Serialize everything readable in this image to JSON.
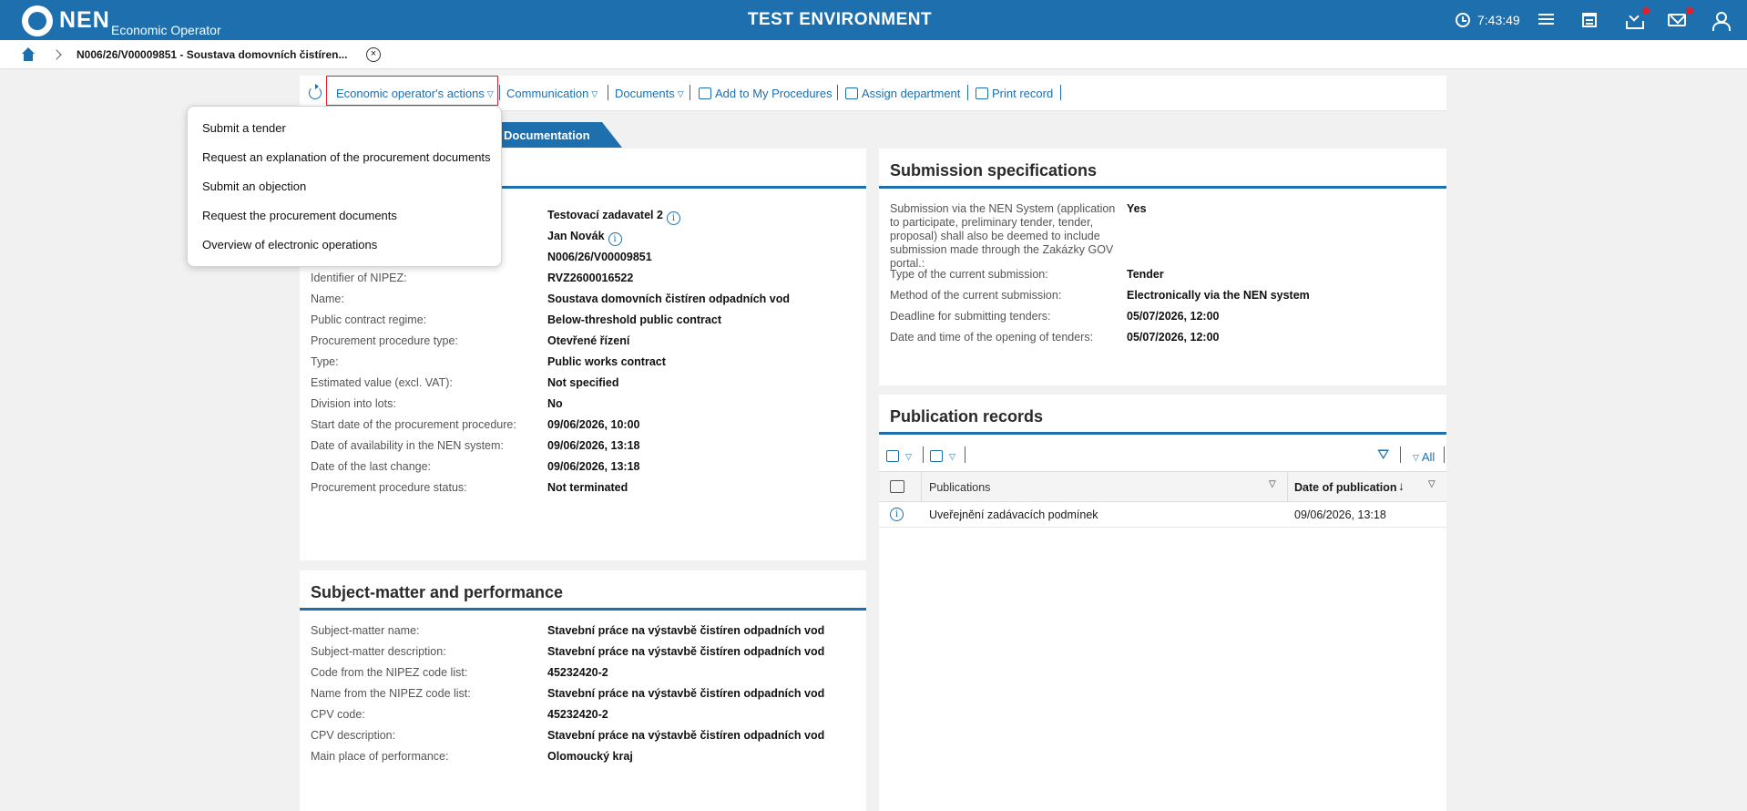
{
  "header": {
    "logo_text": "NEN",
    "logo_subtitle": "Economic Operator",
    "environment": "TEST ENVIRONMENT",
    "clock": "7:43:49",
    "accent": "#1d6fae"
  },
  "breadcrumb": {
    "current": "N006/26/V00009851 - Soustava domovních čistíren..."
  },
  "toolbar": {
    "eo_actions": "Economic operator's actions",
    "communication": "Communication",
    "documents": "Documents",
    "add_to_my": "Add to My Procedures",
    "assign_department": "Assign department",
    "print_record": "Print record"
  },
  "tab": {
    "label": "Documentation"
  },
  "dropdown": {
    "items": [
      "Submit a tender",
      "Request an explanation of the procurement documents",
      "Submit an objection",
      "Request the procurement documents",
      "Overview of electronic operations"
    ]
  },
  "basic": {
    "rows": [
      {
        "label": "",
        "value": "Testovací zadavatel 2"
      },
      {
        "label": "",
        "value": "Jan Novák"
      },
      {
        "label": "",
        "value": "N006/26/V00009851"
      },
      {
        "label": "Identifier of NIPEZ:",
        "value": "RVZ2600016522"
      },
      {
        "label": "Name:",
        "value": "Soustava domovních čistíren odpadních vod"
      },
      {
        "label": "Public contract regime:",
        "value": "Below-threshold public contract"
      },
      {
        "label": "Procurement procedure type:",
        "value": "Otevřené řízení"
      },
      {
        "label": "Type:",
        "value": "Public works contract"
      },
      {
        "label": "Estimated value (excl. VAT):",
        "value": "Not specified"
      },
      {
        "label": "Division into lots:",
        "value": "No"
      },
      {
        "label": "Start date of the procurement procedure:",
        "value": "09/06/2026, 10:00"
      },
      {
        "label": "Date of availability in the NEN system:",
        "value": "09/06/2026, 13:18"
      },
      {
        "label": "Date of the last change:",
        "value": "09/06/2026, 13:18"
      },
      {
        "label": "Procurement procedure status:",
        "value": "Not terminated"
      }
    ]
  },
  "subject": {
    "title": "Subject-matter and performance",
    "rows": [
      {
        "label": "Subject-matter name:",
        "value": "Stavební práce na výstavbě čistíren odpadních vod"
      },
      {
        "label": "Subject-matter description:",
        "value": "Stavební práce na výstavbě čistíren odpadních vod"
      },
      {
        "label": "Code from the NIPEZ code list:",
        "value": "45232420-2"
      },
      {
        "label": "Name from the NIPEZ code list:",
        "value": "Stavební práce na výstavbě čistíren odpadních vod"
      },
      {
        "label": "CPV code:",
        "value": "45232420-2"
      },
      {
        "label": "CPV description:",
        "value": "Stavební práce na výstavbě čistíren odpadních vod"
      },
      {
        "label": "Main place of performance:",
        "value": "Olomoucký kraj"
      }
    ]
  },
  "submission": {
    "title": "Submission specifications",
    "first_label": [
      "Submission via the NEN System (application",
      "to participate, preliminary tender, tender,",
      "proposal) shall also be deemed to include",
      "submission made through the Zakázky GOV",
      "portal.:"
    ],
    "first_value": "Yes",
    "rows": [
      {
        "label": "Type of the current submission:",
        "value": "Tender"
      },
      {
        "label": "Method of the current submission:",
        "value": "Electronically via the NEN system"
      },
      {
        "label": "Deadline for submitting tenders:",
        "value": "05/07/2026, 12:00"
      },
      {
        "label": "Date and time of the opening of tenders:",
        "value": "05/07/2026, 12:00"
      }
    ]
  },
  "publication": {
    "title": "Publication records",
    "filter_all": "All",
    "col_publications": "Publications",
    "col_date": "Date of publication",
    "rows": [
      {
        "publication": "Uveřejnění zadávacích podmínek",
        "date": "09/06/2026, 13:18"
      }
    ]
  }
}
